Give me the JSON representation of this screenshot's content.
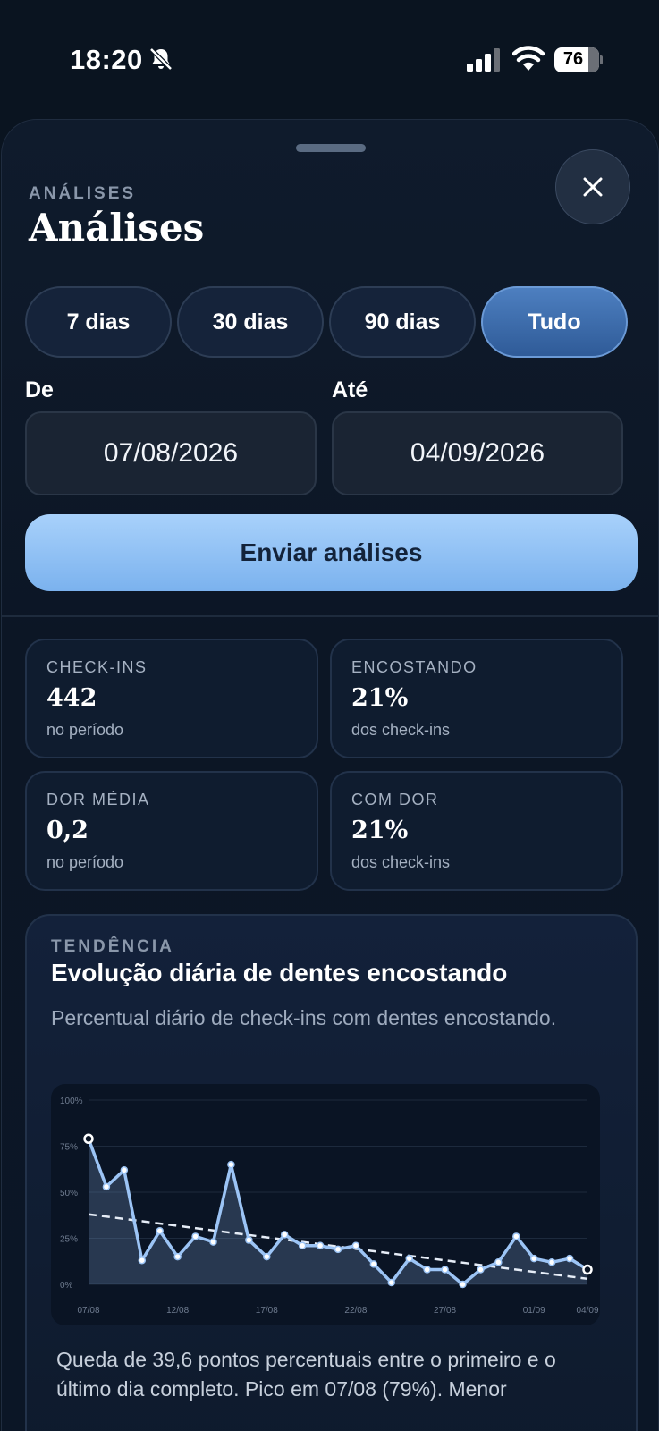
{
  "status_bar": {
    "time": "18:20",
    "battery": "76",
    "icons": [
      "bell-slash-icon",
      "cellular-signal-icon",
      "wifi-icon",
      "battery-icon"
    ]
  },
  "sheet": {
    "eyebrow": "ANÁLISES",
    "title": "Análises",
    "close_icon": "close-icon"
  },
  "range_tabs": [
    {
      "label": "7 dias",
      "active": false
    },
    {
      "label": "30 dias",
      "active": false
    },
    {
      "label": "90 dias",
      "active": false
    },
    {
      "label": "Tudo",
      "active": true
    }
  ],
  "date_range": {
    "from_label": "De",
    "from_value": "07/08/2026",
    "to_label": "Até",
    "to_value": "04/09/2026"
  },
  "send_button": "Enviar análises",
  "stats": [
    {
      "label": "CHECK-INS",
      "value": "442",
      "sub": "no período"
    },
    {
      "label": "ENCOSTANDO",
      "value": "21%",
      "sub": "dos check-ins"
    },
    {
      "label": "DOR MÉDIA",
      "value": "0,2",
      "sub": "no período"
    },
    {
      "label": "COM DOR",
      "value": "21%",
      "sub": "dos check-ins"
    }
  ],
  "trend": {
    "eyebrow": "TENDÊNCIA",
    "title": "Evolução diária de dentes encostando",
    "subtitle": "Percentual diário de check-ins com dentes encostando.",
    "summary": "Queda de 39,6 pontos percentuais entre o primeiro e o último dia completo. Pico em 07/08 (79%). Menor"
  },
  "colors": {
    "accent": "#7bb2ee",
    "line": "#9cc4f5",
    "trend_line": "#e6edf7"
  },
  "chart_data": {
    "type": "line",
    "y_tick_labels": [
      "100%",
      "75%",
      "50%",
      "25%",
      "0%"
    ],
    "x_tick_labels": [
      "07/08",
      "12/08",
      "17/08",
      "22/08",
      "27/08",
      "01/09",
      "04/09"
    ],
    "ylim": [
      0,
      100
    ],
    "grid": true,
    "series": [
      {
        "values": [
          79,
          53,
          62,
          13,
          29,
          15,
          26,
          23,
          65,
          24,
          15,
          27,
          21,
          21,
          19,
          21,
          11,
          1,
          14,
          8,
          8,
          0,
          8,
          12,
          26,
          14,
          12,
          14,
          8
        ]
      }
    ],
    "trend_line": {
      "start": 38,
      "end": 3
    },
    "highlighted_points": [
      0,
      28
    ]
  }
}
